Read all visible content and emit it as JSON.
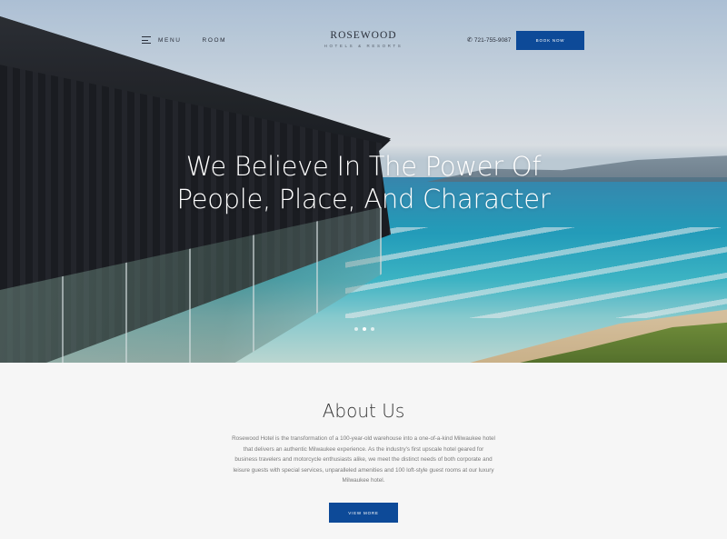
{
  "nav": {
    "menu_label": "MENU",
    "room_label": "ROOM",
    "phone": "721-755-9087",
    "book_label": "BOOK NOW"
  },
  "logo": {
    "main": "ROSEWOOD",
    "sub": "HOTELS & RESORTS"
  },
  "hero": {
    "title_line1": "We Believe In The Power Of",
    "title_line2": "People, Place, And Character",
    "slide_count": 3,
    "active_slide": 2
  },
  "about": {
    "title": "About Us",
    "text": "Rosewood Hotel is the transformation of a 100-year-old warehouse into a one-of-a-kind Milwaukee hotel that delivers an authentic Milwaukee experience. As the industry's first upscale hotel geared for business travelers and motorcycle enthusiasts alike, we meet the distinct needs of both corporate and leisure guests with special services, unparalleled amenities and 100 loft-style guest rooms at our luxury Milwaukee hotel.",
    "button_label": "VIEW MORE"
  },
  "colors": {
    "accent": "#0d4a98",
    "text_dark": "#2a2f3a",
    "body_text": "#7a7a7a"
  },
  "icons": {
    "menu": "hamburger-icon",
    "phone": "phone-icon"
  }
}
